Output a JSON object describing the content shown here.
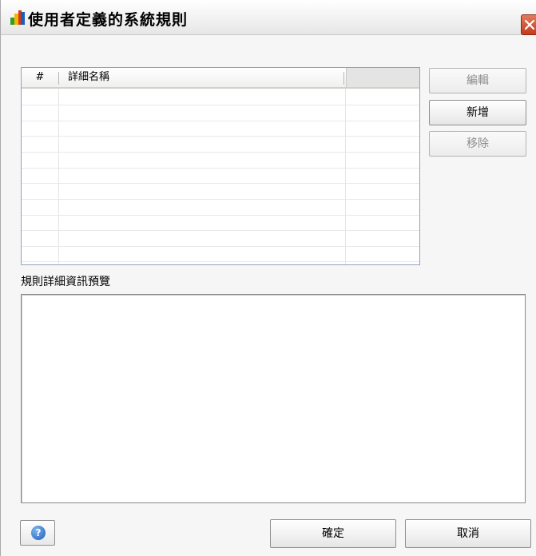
{
  "window": {
    "title": "使用者定義的系統規則"
  },
  "rules_table": {
    "columns": [
      "#",
      "詳細名稱",
      ""
    ],
    "rows": []
  },
  "side_buttons": {
    "edit_label": "編輯",
    "add_label": "新增",
    "remove_label": "移除"
  },
  "preview": {
    "label": "規則詳細資訊預覽",
    "content": ""
  },
  "footer": {
    "ok_label": "確定",
    "cancel_label": "取消"
  },
  "icons": {
    "app": "avg-logo-icon",
    "close": "close-icon",
    "help": "help-icon"
  },
  "colors": {
    "close_button": "#c43b1b",
    "help_icon": "#1d5fb8",
    "table_border": "#8fa3bd"
  }
}
